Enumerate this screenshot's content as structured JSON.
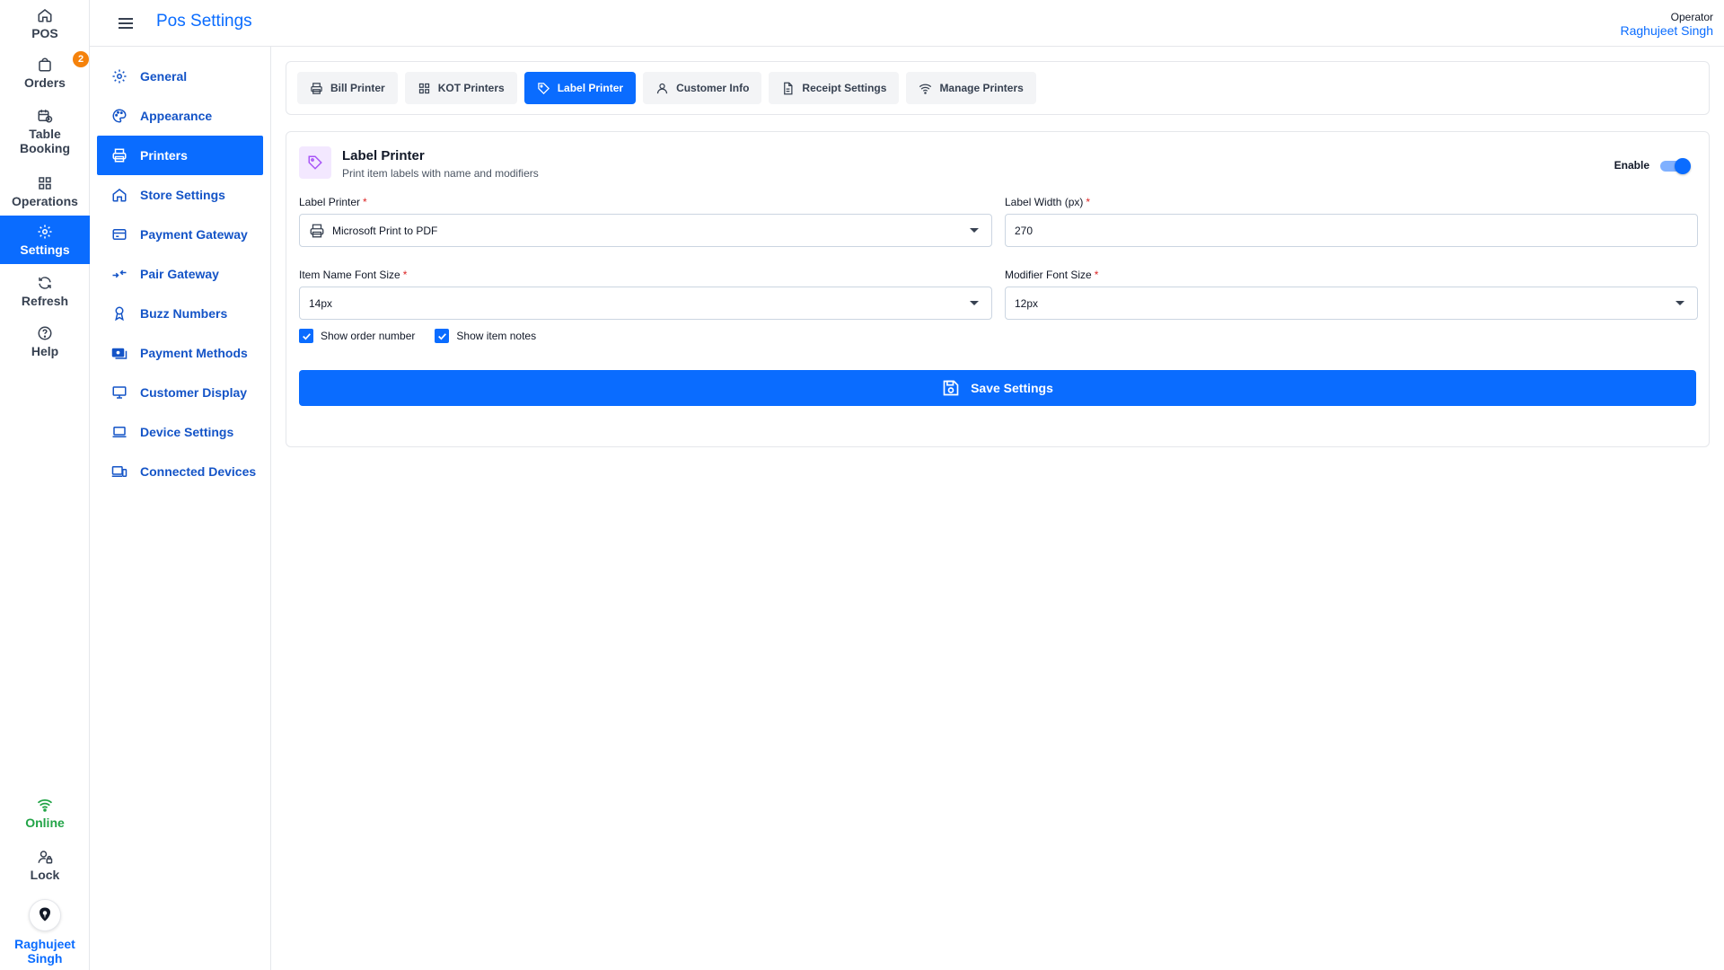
{
  "rail": {
    "pos": "POS",
    "orders": "Orders",
    "orders_badge": "2",
    "table_booking_line1": "Table",
    "table_booking_line2": "Booking",
    "operations": "Operations",
    "settings": "Settings",
    "refresh": "Refresh",
    "help": "Help",
    "status": "Online",
    "lock": "Lock",
    "user_line1": "Raghujeet",
    "user_line2": "Singh"
  },
  "header": {
    "title": "Pos Settings",
    "operator_label": "Operator",
    "operator_name": "Raghujeet Singh"
  },
  "subnav": {
    "items": [
      {
        "label": "General",
        "icon": "gear-icon"
      },
      {
        "label": "Appearance",
        "icon": "palette-icon"
      },
      {
        "label": "Printers",
        "icon": "printer-icon"
      },
      {
        "label": "Store Settings",
        "icon": "home-icon"
      },
      {
        "label": "Payment Gateway",
        "icon": "card-icon"
      },
      {
        "label": "Pair Gateway",
        "icon": "pair-arrows-icon"
      },
      {
        "label": "Buzz Numbers",
        "icon": "buzzer-icon"
      },
      {
        "label": "Payment Methods",
        "icon": "money-icon"
      },
      {
        "label": "Customer Display",
        "icon": "monitor-icon"
      },
      {
        "label": "Device Settings",
        "icon": "laptop-icon"
      },
      {
        "label": "Connected Devices",
        "icon": "devices-icon"
      }
    ],
    "active_index": 2
  },
  "tabs": {
    "items": [
      {
        "label": "Bill Printer",
        "icon": "printer-icon"
      },
      {
        "label": "KOT Printers",
        "icon": "grid-icon"
      },
      {
        "label": "Label Printer",
        "icon": "tag-icon"
      },
      {
        "label": "Customer Info",
        "icon": "user-icon"
      },
      {
        "label": "Receipt Settings",
        "icon": "document-icon"
      },
      {
        "label": "Manage Printers",
        "icon": "wifi-icon"
      }
    ],
    "active_index": 2
  },
  "card": {
    "title": "Label Printer",
    "subtitle": "Print item labels with name and modifiers",
    "enable_label": "Enable",
    "enabled": true
  },
  "form": {
    "label_printer_label": "Label Printer",
    "label_printer_value": "Microsoft Print to PDF",
    "label_width_label": "Label Width (px)",
    "label_width_value": "270",
    "item_font_label": "Item Name Font Size",
    "item_font_value": "14px",
    "modifier_font_label": "Modifier Font Size",
    "modifier_font_value": "12px",
    "required_mark": "*",
    "show_order_number": "Show order number",
    "show_item_notes": "Show item notes",
    "save_label": "Save Settings"
  },
  "colors": {
    "accent": "#0a6cff",
    "online": "#22a447",
    "badge": "#f5820b"
  }
}
